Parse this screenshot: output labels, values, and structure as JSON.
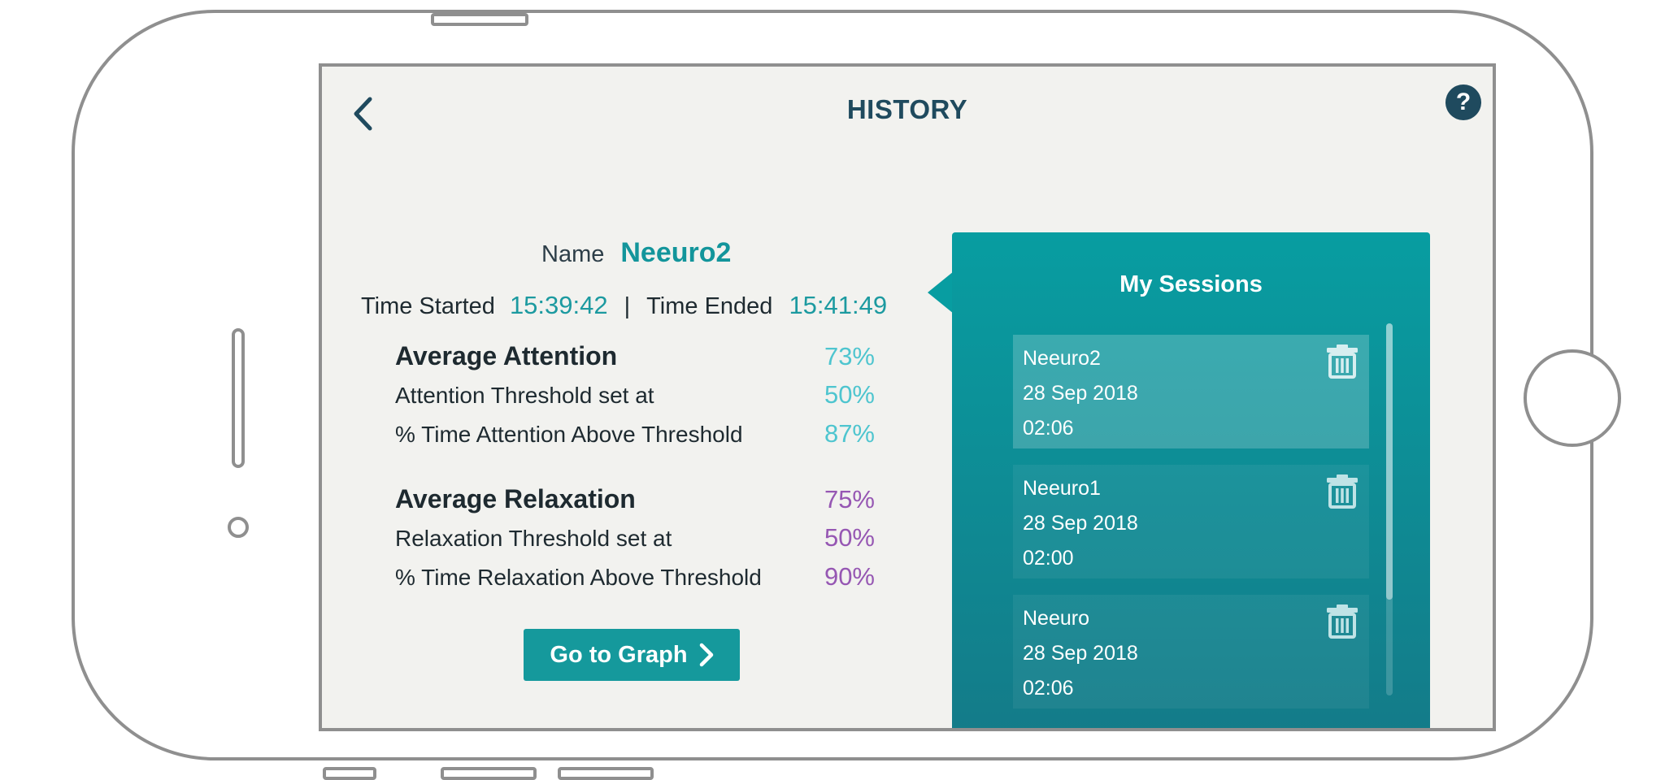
{
  "header": {
    "title": "HISTORY",
    "help_label": "?"
  },
  "summary": {
    "name_label": "Name",
    "name_value": "Neeuro2",
    "time_started_label": "Time Started",
    "time_started_value": "15:39:42",
    "separator": "|",
    "time_ended_label": "Time Ended",
    "time_ended_value": "15:41:49"
  },
  "attention": {
    "average_label": "Average Attention",
    "average_value": "73%",
    "threshold_label": "Attention Threshold set at",
    "threshold_value": "50%",
    "above_label": "% Time Attention Above Threshold",
    "above_value": "87%"
  },
  "relaxation": {
    "average_label": "Average Relaxation",
    "average_value": "75%",
    "threshold_label": "Relaxation Threshold set at",
    "threshold_value": "50%",
    "above_label": "% Time Relaxation Above Threshold",
    "above_value": "90%"
  },
  "graph_button": {
    "label": "Go to Graph"
  },
  "sessions": {
    "title": "My Sessions",
    "items": [
      {
        "name": "Neeuro2",
        "date": "28 Sep 2018",
        "duration": "02:06",
        "selected": true
      },
      {
        "name": "Neeuro1",
        "date": "28 Sep 2018",
        "duration": "02:00",
        "selected": false
      },
      {
        "name": "Neeuro",
        "date": "28 Sep 2018",
        "duration": "02:06",
        "selected": false
      }
    ]
  },
  "colors": {
    "primary_dark": "#1f4a5e",
    "teal": "#13959b",
    "attention": "#4ec5cf",
    "relaxation": "#9657b3",
    "panel_top": "#089da1",
    "panel_bottom": "#147a88",
    "screen_bg": "#f2f2ef"
  },
  "icons": {
    "back": "chevron-left-icon",
    "help": "question-circle-icon",
    "graph_arrow": "chevron-right-icon",
    "delete": "trash-icon"
  }
}
